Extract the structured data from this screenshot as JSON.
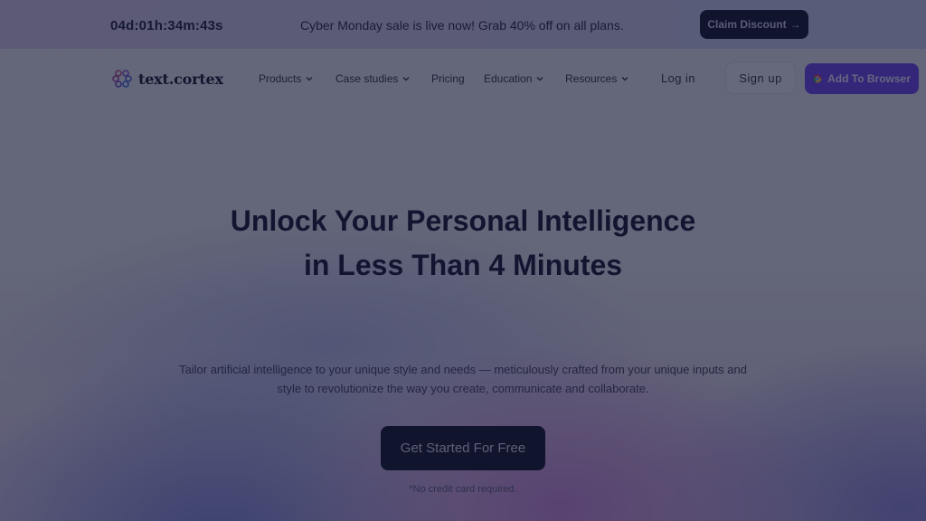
{
  "banner": {
    "countdown": "04d:01h:34m:43s",
    "promo_text": "Cyber Monday sale is live now! Grab 40% off on all plans.",
    "claim_button": "Claim Discount",
    "claim_icon": "arrow-right-icon"
  },
  "nav": {
    "logo_text": "text.cortex",
    "logo_icon": "brain-icon",
    "items": [
      {
        "label": "Products",
        "has_dropdown": true
      },
      {
        "label": "Case studies",
        "has_dropdown": true
      },
      {
        "label": "Pricing",
        "has_dropdown": false
      },
      {
        "label": "Education",
        "has_dropdown": true
      },
      {
        "label": "Resources",
        "has_dropdown": true
      }
    ],
    "login": "Log in",
    "signup": "Sign up",
    "add_to_browser": "Add To Browser",
    "add_to_browser_icon": "chrome-icon"
  },
  "hero": {
    "headline_line1": "Unlock Your Personal Intelligence",
    "headline_line2": "in Less Than 4 Minutes",
    "subtext_line1": "Tailor artificial intelligence to your unique style and needs — meticulously crafted from your unique inputs and",
    "subtext_line2": "style to revolutionize the way you create, communicate and collaborate.",
    "cta": "Get Started For Free",
    "note": "*No credit card required."
  },
  "colors": {
    "accent": "#6a43f0",
    "dark_button": "#0d1128",
    "overlay": "rgba(20,22,48,0.62)"
  }
}
